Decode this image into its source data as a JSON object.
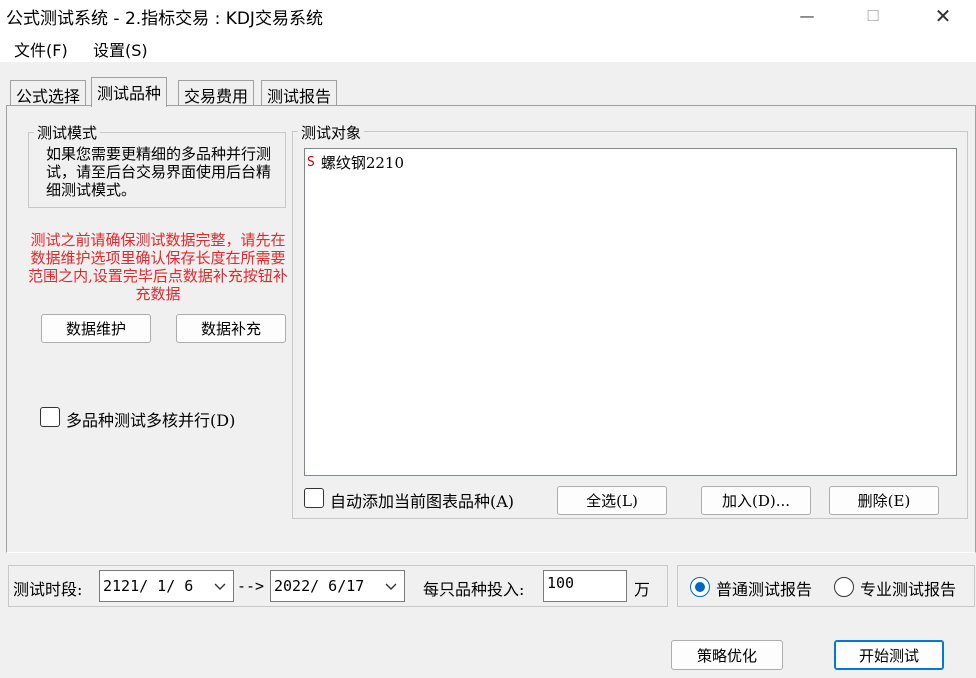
{
  "window": {
    "title": "公式测试系统 - 2.指标交易 : KDJ交易系统",
    "minimize_glyph": "—",
    "maximize_glyph": "☐",
    "close_glyph": "✕"
  },
  "menu": {
    "items": [
      "文件(F)",
      "设置(S)"
    ]
  },
  "tabs": [
    {
      "label": "公式选择",
      "active": false
    },
    {
      "label": "测试品种",
      "active": true
    },
    {
      "label": "交易费用",
      "active": false
    },
    {
      "label": "测试报告",
      "active": false
    }
  ],
  "test_mode": {
    "title": "测试模式",
    "description": "如果您需要更精细的多品种并行测试，请至后台交易界面使用后台精细测试模式。"
  },
  "warning": "测试之前请确保测试数据完整，请先在数据维护选项里确认保存长度在所需要范围之内,设置完毕后点数据补充按钮补充数据",
  "buttons": {
    "data_maintenance": "数据维护",
    "data_supplement": "数据补充",
    "select_all": "全选(L)",
    "add": "加入(D)...",
    "delete": "删除(E)",
    "strategy_optimize": "策略优化",
    "start_test": "开始测试"
  },
  "multicore": {
    "label": "多品种测试多核并行(D)",
    "checked": false
  },
  "test_target": {
    "title": "测试对象",
    "items": [
      {
        "badge": "S",
        "name": "螺纹钢2210",
        "badge_color": "#c00000"
      }
    ]
  },
  "auto_add": {
    "label": "自动添加当前图表品种(A)",
    "checked": false
  },
  "period": {
    "label": "测试时段:",
    "start": "2121/ 1/ 6",
    "arrow": "-->",
    "end": "2022/ 6/17"
  },
  "investment": {
    "label": "每只品种投入:",
    "value": "100",
    "unit": "万"
  },
  "report_type": {
    "options": [
      {
        "label": "普通测试报告",
        "selected": true
      },
      {
        "label": "专业测试报告",
        "selected": false
      }
    ]
  },
  "colors": {
    "accent": "#0067c0",
    "warning": "#e8262c"
  }
}
